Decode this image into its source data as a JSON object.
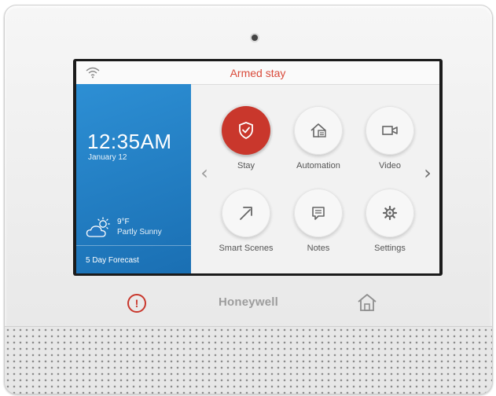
{
  "status_bar": {
    "status_text": "Armed stay",
    "wifi_icon": "wifi-icon"
  },
  "clock_panel": {
    "time": "12:35AM",
    "date": "January 12",
    "weather": {
      "icon": "partly-sunny-icon",
      "temperature": "9°F",
      "condition": "Partly Sunny"
    },
    "forecast_link": "5 Day Forecast"
  },
  "tiles": [
    {
      "label": "Stay",
      "icon": "shield-check-icon",
      "active": true
    },
    {
      "label": "Automation",
      "icon": "home-automation-icon",
      "active": false
    },
    {
      "label": "Video",
      "icon": "video-camera-icon",
      "active": false
    },
    {
      "label": "Smart Scenes",
      "icon": "arrow-up-right-icon",
      "active": false
    },
    {
      "label": "Notes",
      "icon": "message-icon",
      "active": false
    },
    {
      "label": "Settings",
      "icon": "gear-icon",
      "active": false
    }
  ],
  "navigation": {
    "prev_icon": "chevron-left-icon",
    "next_icon": "chevron-right-icon"
  },
  "hardware": {
    "brand": "Honeywell",
    "alert_button_icon": "alert-icon",
    "home_button_icon": "home-icon"
  },
  "colors": {
    "armed_red": "#c9372c",
    "panel_blue": "#1a6fb3",
    "status_text_red": "#d94a3a"
  }
}
